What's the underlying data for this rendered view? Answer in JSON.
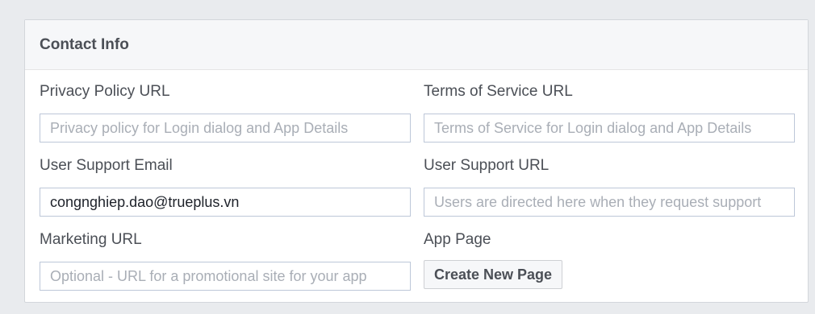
{
  "panel": {
    "title": "Contact Info"
  },
  "fields": {
    "privacy_policy": {
      "label": "Privacy Policy URL",
      "value": "",
      "placeholder": "Privacy policy for Login dialog and App Details"
    },
    "terms_of_service": {
      "label": "Terms of Service URL",
      "value": "",
      "placeholder": "Terms of Service for Login dialog and App Details"
    },
    "user_support_email": {
      "label": "User Support Email",
      "value": "congnghiep.dao@trueplus.vn",
      "placeholder": ""
    },
    "user_support_url": {
      "label": "User Support URL",
      "value": "",
      "placeholder": "Users are directed here when they request support"
    },
    "marketing_url": {
      "label": "Marketing URL",
      "value": "",
      "placeholder": "Optional - URL for a promotional site for your app"
    }
  },
  "app_page": {
    "label": "App Page",
    "button_label": "Create New Page"
  }
}
